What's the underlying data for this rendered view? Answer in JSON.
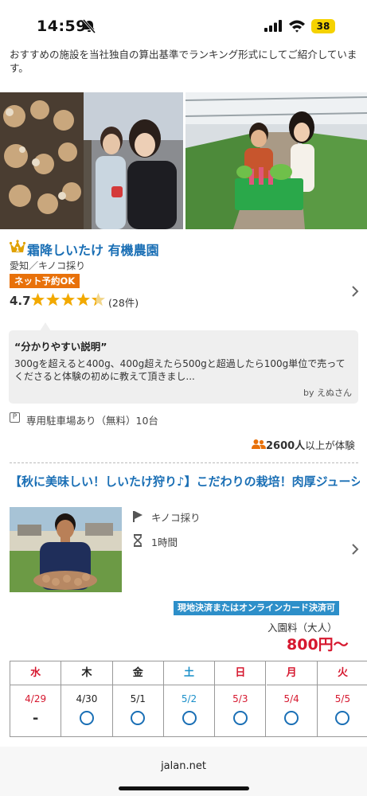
{
  "status_bar": {
    "time": "14:59",
    "battery": "38"
  },
  "intro": {
    "text": "おすすめの施設を当社独自の算出基準でランキング形式にしてご紹介しています。"
  },
  "farm": {
    "name": "霜降しいたけ 有機農園",
    "meta": "愛知／キノコ採り",
    "badge": "ネット予約OK",
    "rating": "4.7",
    "rating_value": 4.7,
    "review_count": "(28件)"
  },
  "review": {
    "title": "“分かりやすい説明”",
    "body": "300gを超えると400g、400g超えたら500gと超過したら100g単位で売ってくださると体験の初めに教えて頂きまし...",
    "author": "by えぬさん"
  },
  "parking": {
    "icon_label": "P",
    "text": "専用駐車場あり（無料）10台"
  },
  "experienced": {
    "count": "2600人",
    "suffix": "以上が体験"
  },
  "plan": {
    "title": "【秋に美味しい！しいたけ狩り♪】こだわりの栽培！肉厚ジューシーで、段違いな美味しさのしいたけを自分で収穫...",
    "category": "キノコ採り",
    "duration": "1時間",
    "payment_badge": "現地決済またはオンラインカード決済可",
    "fee_label": "入園料（大人）",
    "fee_price": "800円〜"
  },
  "calendar": {
    "days": [
      {
        "day": "水",
        "date": "4/29",
        "available": false,
        "day_color": "#d6182f",
        "date_color": "#d6182f"
      },
      {
        "day": "木",
        "date": "4/30",
        "available": true,
        "day_color": "#222222",
        "date_color": "#222222"
      },
      {
        "day": "金",
        "date": "5/1",
        "available": true,
        "day_color": "#222222",
        "date_color": "#222222"
      },
      {
        "day": "土",
        "date": "5/2",
        "available": true,
        "day_color": "#1a8fc9",
        "date_color": "#1a8fc9"
      },
      {
        "day": "日",
        "date": "5/3",
        "available": true,
        "day_color": "#d6182f",
        "date_color": "#d6182f"
      },
      {
        "day": "月",
        "date": "5/4",
        "available": true,
        "day_color": "#d6182f",
        "date_color": "#d6182f"
      },
      {
        "day": "火",
        "date": "5/5",
        "available": true,
        "day_color": "#d6182f",
        "date_color": "#d6182f"
      }
    ],
    "unavailable_mark": "-"
  },
  "browser": {
    "domain": "jalan.net"
  },
  "colors": {
    "link_blue": "#1a6fb5",
    "star_gold": "#f2a900",
    "badge_orange": "#e8710a",
    "price_red": "#d6182f",
    "payment_blue": "#2d8fc9"
  }
}
